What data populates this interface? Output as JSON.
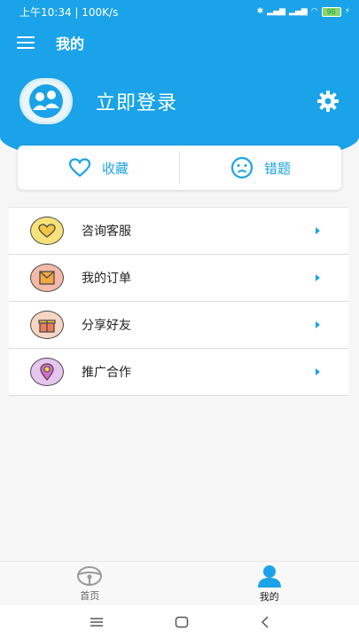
{
  "status_bar": {
    "time": "上午10:34 | 100K/s",
    "battery": "96"
  },
  "appbar": {
    "title": "我的"
  },
  "profile": {
    "login_label": "立即登录"
  },
  "quick_actions": [
    {
      "label": "收藏",
      "icon": "heart-icon"
    },
    {
      "label": "错题",
      "icon": "sad-face-icon"
    }
  ],
  "menu": [
    {
      "label": "咨询客服",
      "icon": "heart-badge-icon"
    },
    {
      "label": "我的订单",
      "icon": "envelope-icon"
    },
    {
      "label": "分享好友",
      "icon": "gift-icon"
    },
    {
      "label": "推广合作",
      "icon": "location-pin-icon"
    }
  ],
  "tabbar": [
    {
      "label": "首页",
      "icon": "steering-wheel-icon"
    },
    {
      "label": "我的",
      "icon": "person-icon"
    }
  ],
  "colors": {
    "accent": "#1aa3e8"
  }
}
